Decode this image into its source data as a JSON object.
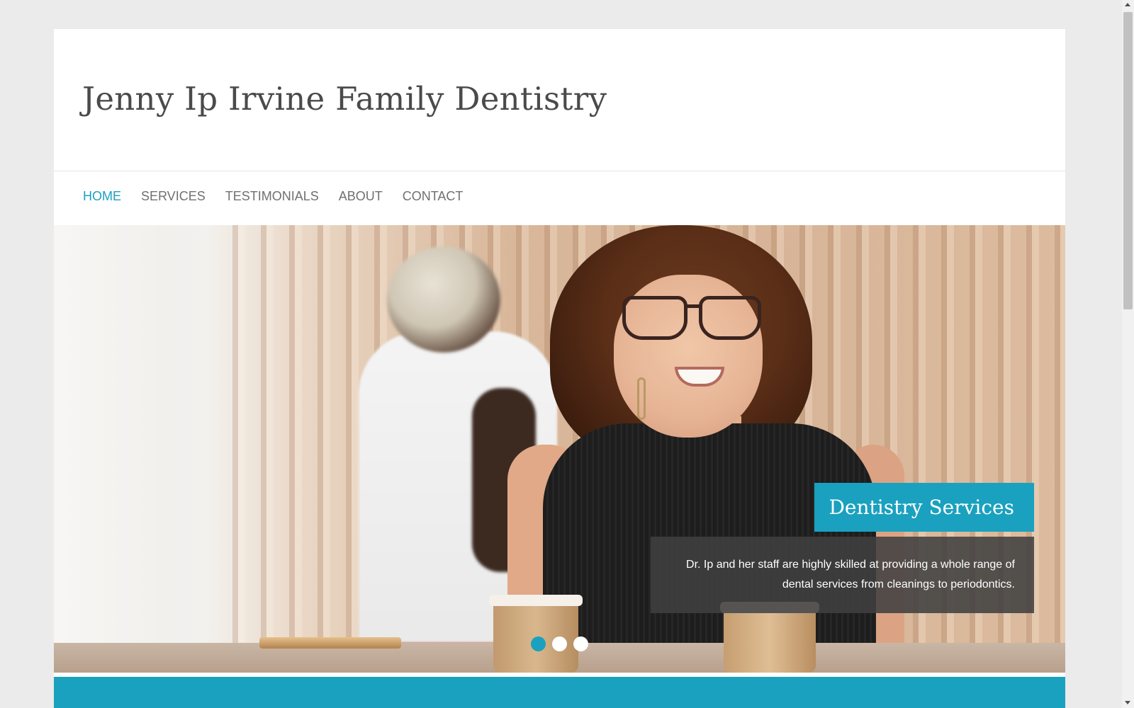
{
  "header": {
    "site_title": "Jenny Ip Irvine Family Dentistry"
  },
  "nav": {
    "items": [
      {
        "label": "HOME",
        "active": true
      },
      {
        "label": "SERVICES",
        "active": false
      },
      {
        "label": "TESTIMONIALS",
        "active": false
      },
      {
        "label": "ABOUT",
        "active": false
      },
      {
        "label": "CONTACT",
        "active": false
      }
    ]
  },
  "hero": {
    "caption_title": "Dentistry Services",
    "caption_text": "Dr. Ip and her staff are highly skilled at providing a whole range of dental services from cleanings to periodontics.",
    "slides": {
      "count": 3,
      "active_index": 0
    }
  },
  "colors": {
    "accent": "#1aa1bf",
    "text_dark": "#4a4a4a",
    "nav_text": "#707070",
    "caption_bg": "#404040",
    "page_bg": "#ebebeb"
  },
  "icons": [
    "scroll-up-icon",
    "scroll-down-icon"
  ]
}
